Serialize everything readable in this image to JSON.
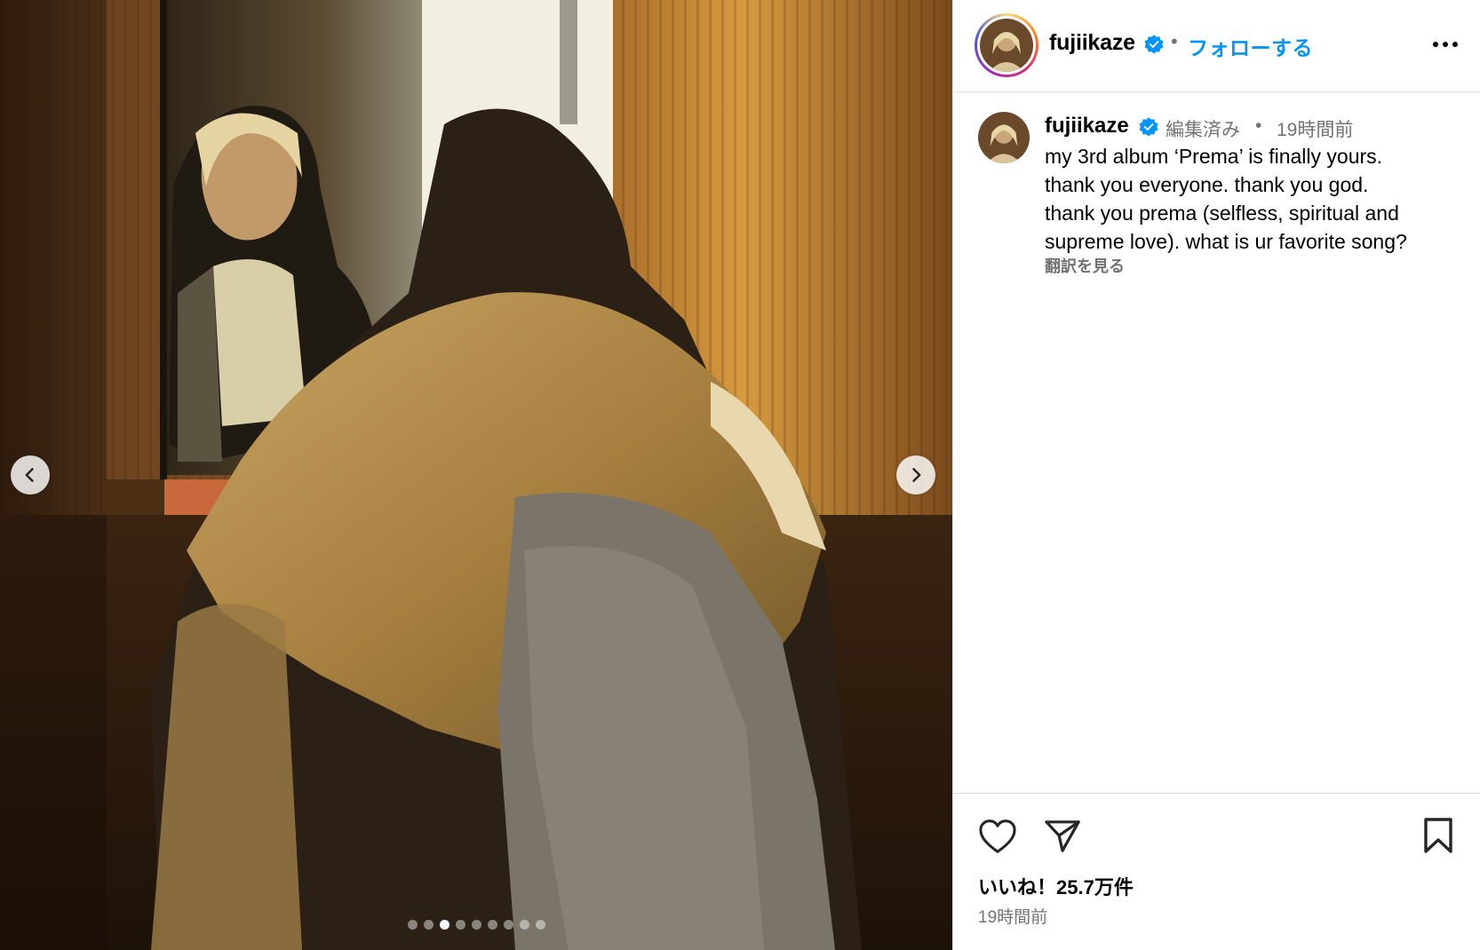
{
  "post": {
    "username": "fujiikaze",
    "follow_label": "フォローする",
    "separator": "•",
    "caption": {
      "username": "fujiikaze",
      "edited_label": "編集済み",
      "separator": "•",
      "time": "19時間前",
      "lines": [
        "my 3rd album ‘Prema’ is finally yours.",
        "thank you everyone. thank you god.",
        "thank you prema (selfless, spiritual and",
        "supreme love). what is ur favorite song?"
      ],
      "see_translation": "翻訳を見る"
    },
    "likes": "いいね！25.7万件",
    "timestamp": "19時間前"
  },
  "carousel": {
    "total": 9,
    "active_index": 2
  },
  "icons": {
    "verified": "verified-badge-icon",
    "more": "more-options-icon",
    "prev": "chevron-left-icon",
    "next": "chevron-right-icon",
    "like": "heart-icon",
    "share": "paper-plane-icon",
    "save": "bookmark-icon"
  },
  "colors": {
    "link": "#0095f6",
    "verified": "#0095f6",
    "secondary_text": "#737373"
  }
}
